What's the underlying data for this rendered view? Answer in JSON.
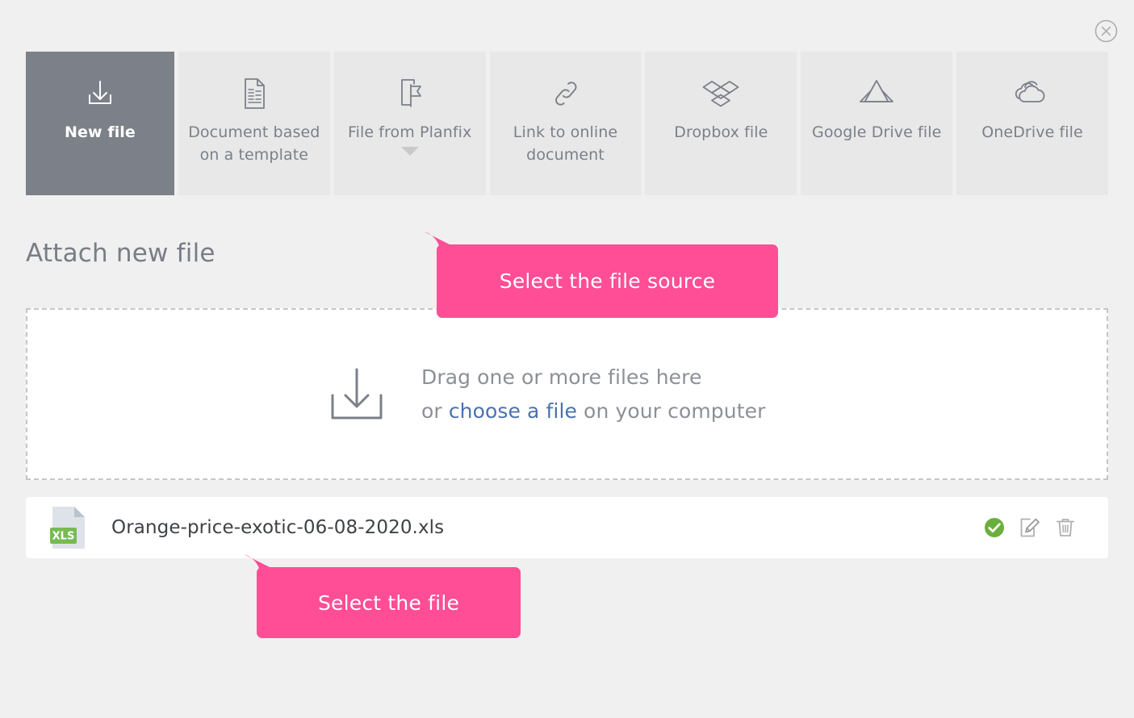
{
  "dialog": {
    "close_icon": "close-circle-icon"
  },
  "source_tabs": [
    {
      "label": "New file",
      "icon": "download-tray-icon",
      "active": true,
      "has_caret": false
    },
    {
      "label": "Document based on a template",
      "icon": "document-lines-icon",
      "active": false,
      "has_caret": false
    },
    {
      "label": "File from Planfix",
      "icon": "file-flag-icon",
      "active": false,
      "has_caret": true
    },
    {
      "label": "Link to online document",
      "icon": "chain-link-icon",
      "active": false,
      "has_caret": false
    },
    {
      "label": "Dropbox file",
      "icon": "dropbox-icon",
      "active": false,
      "has_caret": false
    },
    {
      "label": "Google Drive file",
      "icon": "google-drive-icon",
      "active": false,
      "has_caret": false
    },
    {
      "label": "OneDrive file",
      "icon": "onedrive-cloud-icon",
      "active": false,
      "has_caret": false
    }
  ],
  "section": {
    "title": "Attach new file"
  },
  "dropzone": {
    "icon": "download-tray-icon",
    "line1": "Drag one or more files here",
    "line2_prefix": "or ",
    "line2_link": "choose a file",
    "line2_suffix": " on your computer"
  },
  "attached_file": {
    "type_badge": "XLS",
    "icon": "xls-file-icon",
    "name": "Orange-price-exotic-06-08-2020.xls",
    "actions": [
      {
        "name": "confirm-check-icon",
        "label": "Confirm"
      },
      {
        "name": "edit-pencil-icon",
        "label": "Edit"
      },
      {
        "name": "delete-trash-icon",
        "label": "Delete"
      }
    ]
  },
  "callouts": [
    {
      "text": "Select the file source"
    },
    {
      "text": "Select the file"
    }
  ],
  "colors": {
    "page_background": "#f0f0f0",
    "tab_inactive": "#e8e8e8",
    "tab_active": "#7c8089",
    "accent_pink": "#ff4d96",
    "link_blue": "#4a72b0",
    "check_green": "#6aaf3d",
    "xls_badge_green": "#76bb52",
    "text_gray": "#7b8089"
  }
}
